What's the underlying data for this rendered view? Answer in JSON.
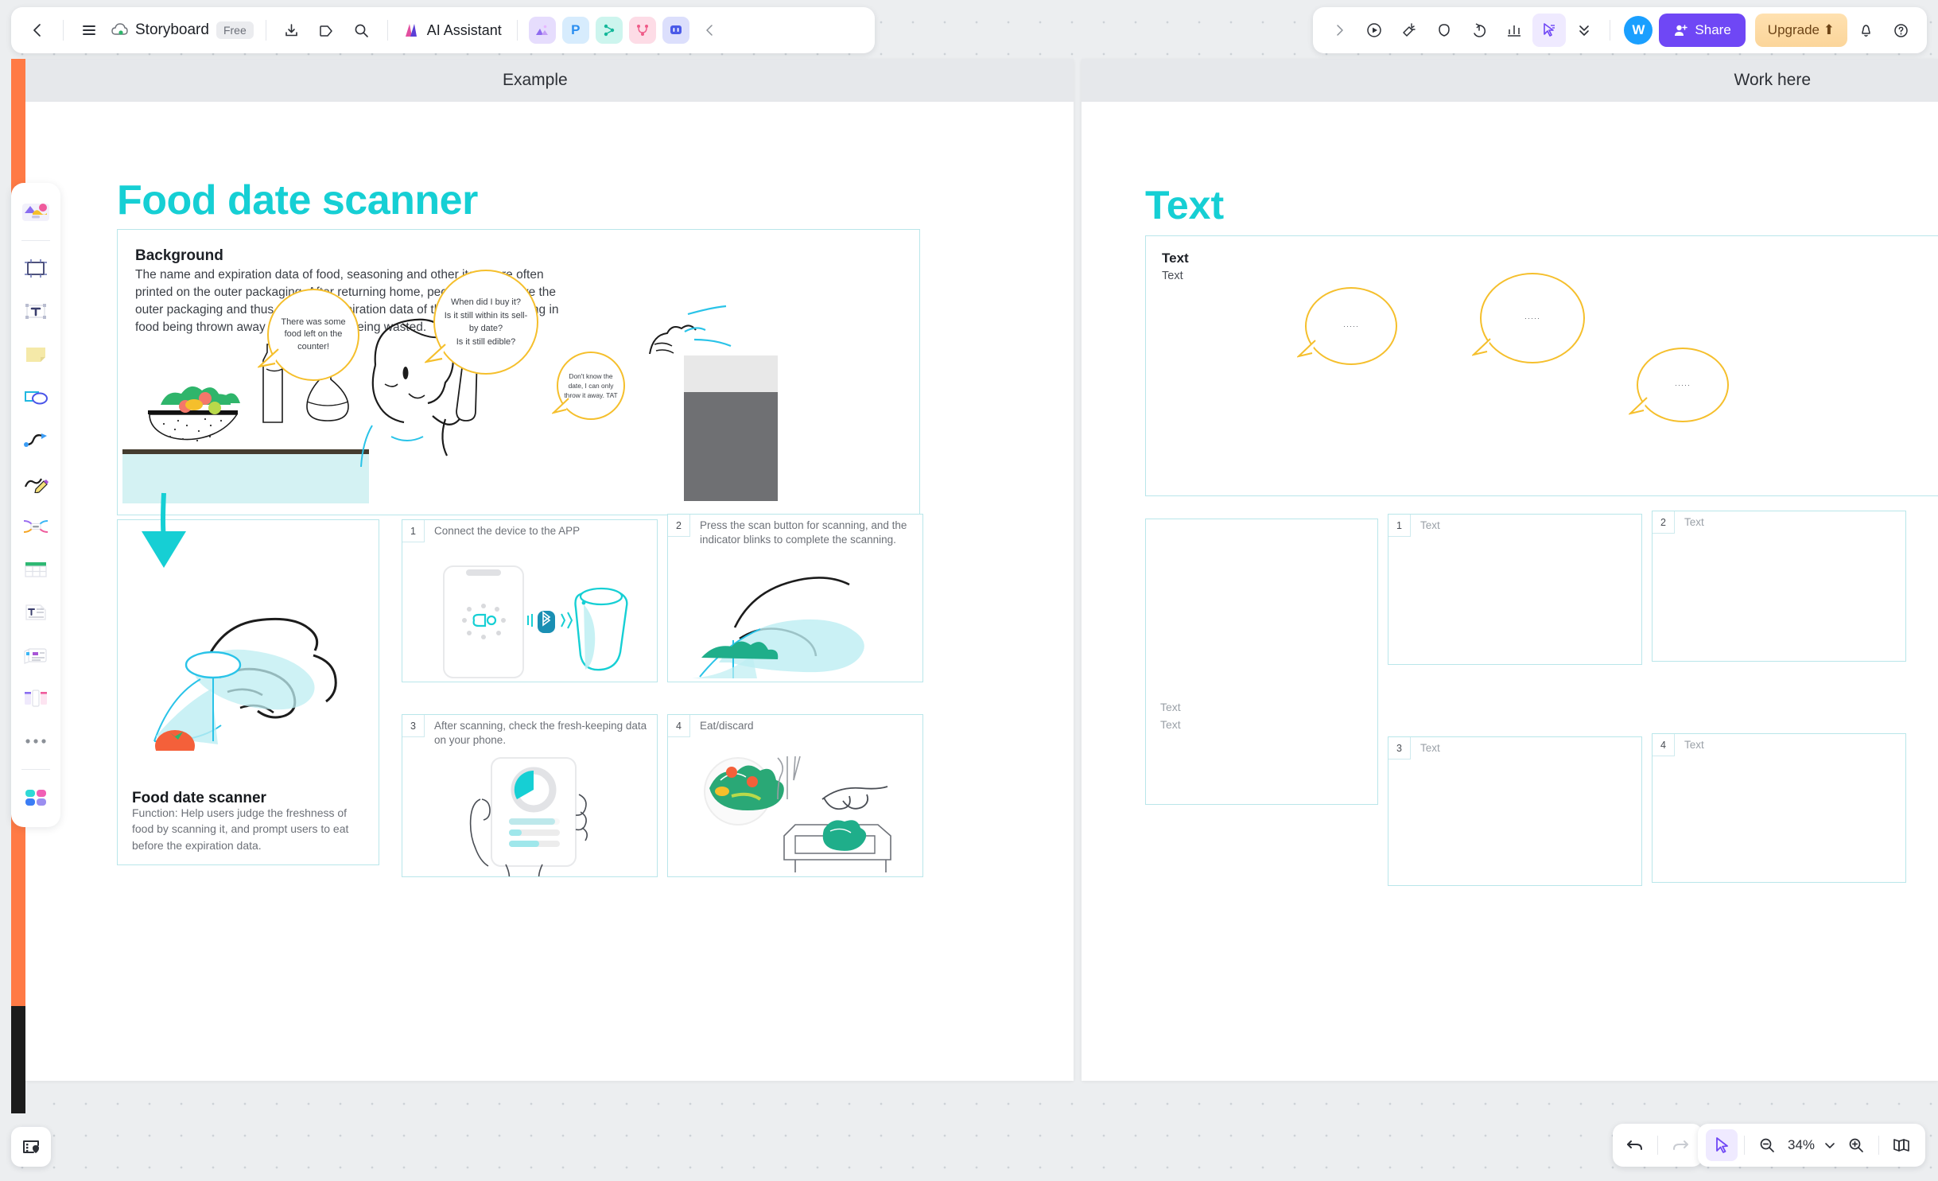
{
  "topbar": {
    "back_icon": "chevron-left-icon",
    "menu_icon": "hamburger-menu-icon",
    "cloud_icon": "cloud-sync-icon",
    "doc_title": "Storyboard",
    "plan_badge": "Free",
    "download_icon": "download-icon",
    "tag_icon": "tag-icon",
    "search_icon": "search-icon",
    "ai_label": "AI Assistant",
    "mini_apps": [
      {
        "name": "image-app",
        "glyph": "◢",
        "bg": "#e6ddfd",
        "fg": "#8f6bf0"
      },
      {
        "name": "presentation-app",
        "glyph": "P",
        "bg": "#d7ecfd",
        "fg": "#2b8ef0"
      },
      {
        "name": "mindmap-app",
        "glyph": "⚇",
        "bg": "#cdf5ee",
        "fg": "#14b89a"
      },
      {
        "name": "flowchart-app",
        "glyph": "⑂",
        "bg": "#fddce6",
        "fg": "#ef5b88"
      },
      {
        "name": "comment-app",
        "glyph": "▭",
        "bg": "#dcdffc",
        "fg": "#4a5ae8"
      }
    ],
    "collapse_icon": "chevron-left-icon"
  },
  "topbar_right": {
    "expand_icon": "chevron-right-icon",
    "present_icon": "play-circle-icon",
    "megaphone_icon": "megaphone-icon",
    "comment_icon": "comment-icon",
    "timer_icon": "timer-icon",
    "vote_icon": "bar-chart-icon",
    "cursor_icon": "cursor-select-icon",
    "more_icon": "chevrons-down-icon",
    "avatar_initial": "W",
    "avatar_color": "#1a9fff",
    "share_label": "Share",
    "share_icon": "person-add-icon",
    "share_color": "#6f47f5",
    "upgrade_label": "Upgrade",
    "upgrade_icon": "arrow-up-icon",
    "bell_icon": "bell-icon",
    "help_icon": "help-circle-icon"
  },
  "rail": [
    {
      "name": "templates",
      "icon": "templates-gallery-icon"
    },
    {
      "name": "frame",
      "icon": "frame-icon"
    },
    {
      "name": "text",
      "icon": "text-box-icon"
    },
    {
      "name": "sticky-note",
      "icon": "sticky-note-icon"
    },
    {
      "name": "shapes",
      "icon": "shapes-icon"
    },
    {
      "name": "connector",
      "icon": "connector-line-icon"
    },
    {
      "name": "pen",
      "icon": "pen-draw-icon"
    },
    {
      "name": "mindmap",
      "icon": "mindmap-icon"
    },
    {
      "name": "table",
      "icon": "table-icon"
    },
    {
      "name": "document",
      "icon": "document-text-icon"
    },
    {
      "name": "card",
      "icon": "card-stack-icon"
    },
    {
      "name": "kanban",
      "icon": "kanban-board-icon"
    },
    {
      "name": "more",
      "icon": "more-dots-icon"
    },
    {
      "name": "colors",
      "icon": "color-palette-icon"
    }
  ],
  "boards": {
    "left_header": "Example",
    "right_header": "Work here"
  },
  "example": {
    "title": "Food date scanner",
    "background_heading": "Background",
    "background_body": "The name and expiration data of food, seasoning and other items are often printed on the outer packaging. After returning home, people may remove the outer packaging and thus forget the expiration data of the product, resulting in food being thrown away and resources being wasted.",
    "bubbles": [
      {
        "name": "bubble-counter",
        "text": "There was some food left on the counter!"
      },
      {
        "name": "bubble-questions",
        "text": "When did I buy it?\nIs it still within its sell-by date?\nIs it still edible?"
      },
      {
        "name": "bubble-throw-away",
        "text": "Don't know the date, I can only throw it away. TAT"
      }
    ],
    "product_title": "Food date scanner",
    "product_desc": "Function: Help users judge the freshness of food by scanning it, and prompt users to eat before the expiration data.",
    "steps": [
      {
        "num": "1",
        "text": "Connect the device to the APP"
      },
      {
        "num": "2",
        "text": "Press the scan button for scanning, and the indicator blinks to complete the scanning."
      },
      {
        "num": "3",
        "text": "After scanning, check the fresh-keeping data on your phone."
      },
      {
        "num": "4",
        "text": "Eat/discard"
      }
    ]
  },
  "work": {
    "title": "Text",
    "card_heading": "Text",
    "card_sub": "Text",
    "bubbles": [
      {
        "name": "bubble-placeholder-1",
        "text": "·····"
      },
      {
        "name": "bubble-placeholder-2",
        "text": "·····"
      },
      {
        "name": "bubble-placeholder-3",
        "text": "·····"
      }
    ],
    "left_panel_texts": [
      "Text",
      "Text"
    ],
    "steps": [
      {
        "num": "1",
        "text": "Text"
      },
      {
        "num": "2",
        "text": "Text"
      },
      {
        "num": "3",
        "text": "Text"
      },
      {
        "num": "4",
        "text": "Text"
      }
    ]
  },
  "bottombar": {
    "board_list_icon": "board-list-location-icon",
    "undo_icon": "undo-arrow-icon",
    "redo_icon": "redo-arrow-icon",
    "cursor_icon": "cursor-pointer-icon",
    "zoom_out_icon": "zoom-out-icon",
    "zoom_level": "34%",
    "zoom_dropdown_icon": "chevron-down-icon",
    "zoom_in_icon": "zoom-in-icon",
    "minimap_icon": "minimap-book-icon"
  },
  "colors": {
    "brand_teal": "#16cfd4",
    "highlight_teal": "#d4f4f5",
    "accent_purple": "#6f47f5",
    "bubble_yellow": "#f5bf2c",
    "upgrade_amber": "#ffe1b0"
  }
}
